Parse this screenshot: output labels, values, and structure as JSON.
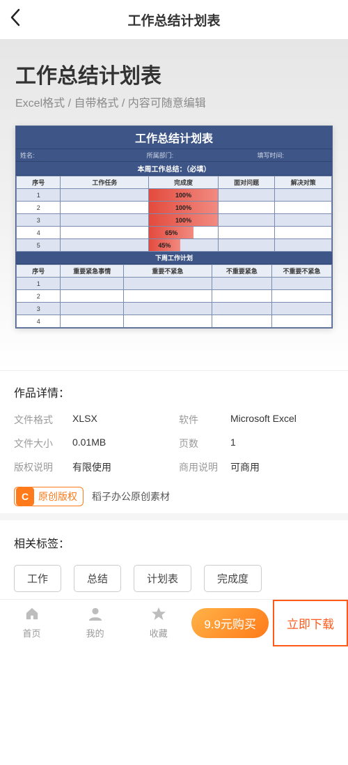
{
  "header": {
    "title": "工作总结计划表"
  },
  "preview": {
    "title": "工作总结计划表",
    "subtitle": "Excel格式 / 自带格式 / 内容可随意编辑",
    "sheet": {
      "title": "工作总结计划表",
      "meta": {
        "name_label": "姓名:",
        "dept_label": "所属部门:",
        "time_label": "填写时间:"
      },
      "section1_band": "本周工作总结：（必填）",
      "section1_headers": [
        "序号",
        "工作任务",
        "完成度",
        "面对问题",
        "解决对策"
      ],
      "section1_rows": [
        {
          "no": "1",
          "progress_label": "100%",
          "progress_pct": 100
        },
        {
          "no": "2",
          "progress_label": "100%",
          "progress_pct": 100
        },
        {
          "no": "3",
          "progress_label": "100%",
          "progress_pct": 100
        },
        {
          "no": "4",
          "progress_label": "65%",
          "progress_pct": 65
        },
        {
          "no": "5",
          "progress_label": "45%",
          "progress_pct": 45
        }
      ],
      "section2_band": "下周工作计划",
      "section2_headers": [
        "序号",
        "重要紧急事情",
        "重要不紧急",
        "不重要紧急",
        "不重要不紧急"
      ],
      "section2_rows": [
        {
          "no": "1"
        },
        {
          "no": "2"
        },
        {
          "no": "3"
        },
        {
          "no": "4"
        }
      ]
    }
  },
  "details": {
    "heading": "作品详情：",
    "rows": [
      {
        "l1": "文件格式",
        "v1": "XLSX",
        "l2": "软件",
        "v2": "Microsoft Excel"
      },
      {
        "l1": "文件大小",
        "v1": "0.01MB",
        "l2": "页数",
        "v2": "1"
      },
      {
        "l1": "版权说明",
        "v1": "有限使用",
        "l2": "商用说明",
        "v2": "可商用"
      }
    ],
    "copyright_icon": "C",
    "copyright_label": "原创版权",
    "copyright_note": "稻子办公原创素材"
  },
  "tags": {
    "heading": "相关标签：",
    "items": [
      "工作",
      "总结",
      "计划表",
      "完成度"
    ]
  },
  "bottom": {
    "nav": [
      {
        "icon": "home",
        "label": "首页"
      },
      {
        "icon": "user",
        "label": "我的"
      },
      {
        "icon": "star",
        "label": "收藏"
      }
    ],
    "buy_label": "9.9元购买",
    "download_label": "立即下载"
  }
}
